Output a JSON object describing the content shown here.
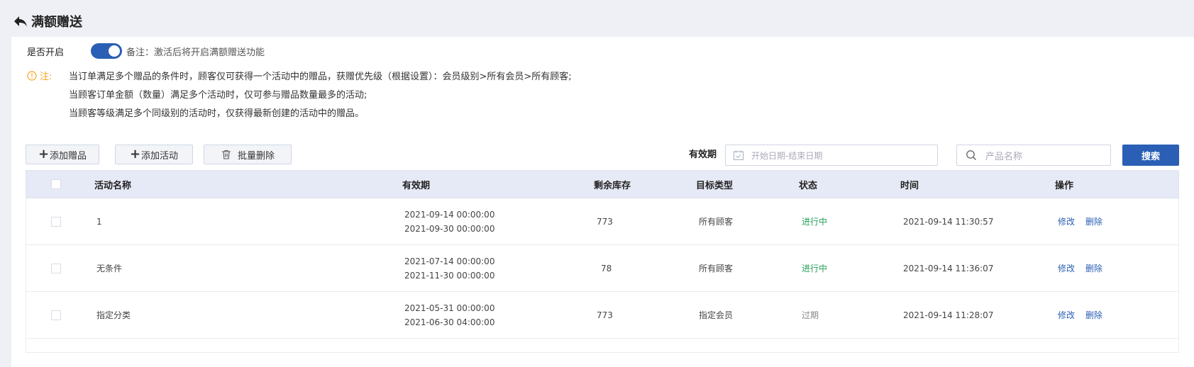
{
  "page": {
    "title": "满额赠送"
  },
  "enable": {
    "label": "是否开启",
    "note": "备注：激活后将开启满额赠送功能",
    "on": true
  },
  "notice": {
    "prefix": "注:",
    "lines": [
      "当订单满足多个赠品的条件时，顾客仅可获得一个活动中的赠品，获赠优先级（根据设置）：会员级别>所有会员>所有顾客;",
      "当顾客订单金额（数量）满足多个活动时，仅可参与赠品数量最多的活动;",
      "当顾客等级满足多个同级别的活动时，仅获得最新创建的活动中的赠品。"
    ]
  },
  "toolbar": {
    "add_gift": "添加赠品",
    "add_activity": "添加活动",
    "batch_delete": "批量删除",
    "validity_label": "有效期",
    "date_placeholder": "开始日期-结束日期",
    "search_placeholder": "产品名称",
    "search_button": "搜索"
  },
  "table": {
    "headers": [
      "活动名称",
      "有效期",
      "剩余库存",
      "目标类型",
      "状态",
      "时间",
      "操作"
    ],
    "rows": [
      {
        "name": "1",
        "start": "2021-09-14 00:00:00",
        "end": "2021-09-30 00:00:00",
        "stock": "773",
        "target": "所有顾客",
        "status": "进行中",
        "status_type": "active",
        "time": "2021-09-14 11:30:57",
        "edit": "修改",
        "delete": "删除"
      },
      {
        "name": "无条件",
        "start": "2021-07-14 00:00:00",
        "end": "2021-11-30 00:00:00",
        "stock": "78",
        "target": "所有顾客",
        "status": "进行中",
        "status_type": "active",
        "time": "2021-09-14 11:36:07",
        "edit": "修改",
        "delete": "删除"
      },
      {
        "name": "指定分类",
        "start": "2021-05-31 00:00:00",
        "end": "2021-06-30 04:00:00",
        "stock": "773",
        "target": "指定会员",
        "status": "过期",
        "status_type": "expired",
        "time": "2021-09-14 11:28:07",
        "edit": "修改",
        "delete": "删除"
      }
    ]
  },
  "colors": {
    "primary": "#2a5fb5",
    "active": "#27a05a",
    "warning": "#f5a623"
  }
}
